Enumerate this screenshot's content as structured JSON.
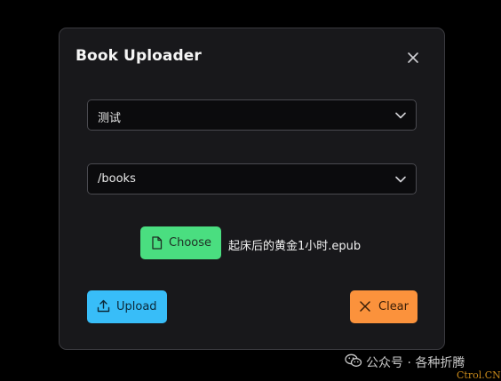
{
  "dialog": {
    "title": "Book Uploader",
    "close_icon": "close-icon"
  },
  "selects": {
    "library": {
      "value": "测试",
      "icon": "chevron-down-icon"
    },
    "path": {
      "value": "/books",
      "icon": "chevron-down-icon"
    }
  },
  "file": {
    "choose_label": "Choose",
    "choose_icon": "file-icon",
    "file_name": "起床后的黄金1小时.epub"
  },
  "actions": {
    "upload_label": "Upload",
    "upload_icon": "upload-icon",
    "clear_label": "Clear",
    "clear_icon": "x-icon"
  },
  "watermark": {
    "text": "公众号 · 各种折腾",
    "icon": "wechat-icon",
    "corner_text": "Ctrol.CN"
  },
  "colors": {
    "background": "#000000",
    "dialog_bg": "#18181b",
    "select_bg": "#0b0b0d",
    "choose_green": "#4ade80",
    "upload_blue": "#38bdf8",
    "clear_orange": "#fb923c"
  }
}
